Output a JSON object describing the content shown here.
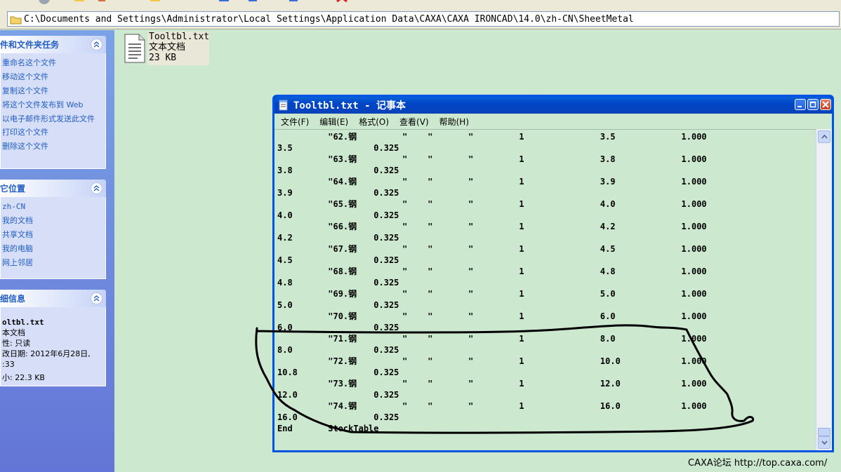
{
  "address_bar": {
    "path": "C:\\Documents and Settings\\Administrator\\Local Settings\\Application Data\\CAXA\\CAXA IRONCAD\\14.0\\zh-CN\\SheetMetal"
  },
  "task_pane": {
    "file_tasks": {
      "title": "件和文件夹任务",
      "items": [
        "重命名这个文件",
        "移动这个文件",
        "复制这个文件",
        "将这个文件发布到 Web",
        "以电子邮件形式发送此文件",
        "打印这个文件",
        "删除这个文件"
      ]
    },
    "other_places": {
      "title": "它位置",
      "items": [
        "zh-CN",
        "我的文档",
        "共享文档",
        "我的电脑",
        "网上邻居"
      ]
    },
    "details": {
      "title": "细信息",
      "lines": [
        "oltbl.txt",
        "本文档",
        "性: 只读",
        "改日期: 2012年6月28日, ",
        ":33",
        "小: 22.3 KB"
      ]
    }
  },
  "file_item": {
    "name": "Tooltbl.txt",
    "type": "文本文档",
    "size": "23 KB",
    "icon": "text-file-icon"
  },
  "notepad": {
    "title": "Tooltbl.txt - 记事本",
    "menus": [
      "文件(F)",
      "编辑(E)",
      "格式(O)",
      "查看(V)",
      "帮助(H)"
    ],
    "lines": [
      "          \"62.钢         \"    \"       \"         1               3.5             1.000",
      "3.5                0.325",
      "          \"63.钢         \"    \"       \"         1               3.8             1.000",
      "3.8                0.325",
      "          \"64.钢         \"    \"       \"         1               3.9             1.000",
      "3.9                0.325",
      "          \"65.钢         \"    \"       \"         1               4.0             1.000",
      "4.0                0.325",
      "          \"66.钢         \"    \"       \"         1               4.2             1.000",
      "4.2                0.325",
      "          \"67.钢         \"    \"       \"         1               4.5             1.000",
      "4.5                0.325",
      "          \"68.钢         \"    \"       \"         1               4.8             1.000",
      "4.8                0.325",
      "          \"69.钢         \"    \"       \"         1               5.0             1.000",
      "5.0                0.325",
      "          \"70.钢         \"    \"       \"         1               6.0             1.000",
      "6.0                0.325",
      "          \"71.钢         \"    \"       \"         1               8.0             1.000",
      "8.0                0.325",
      "          \"72.钢         \"    \"       \"         1               10.0            1.000",
      "10.8               0.325",
      "          \"73.钢         \"    \"       \"         1               12.0            1.000",
      "12.0               0.325",
      "          \"74.钢         \"    \"       \"         1               16.0            1.000",
      "16.0               0.325",
      "End       StockTable"
    ]
  },
  "watermark": "CAXA论坛 http://top.caxa.com/",
  "colors": {
    "workspace_bg": "#cce8cf",
    "titlebar": "#0a5fd8",
    "taskpane": "#6b8be0",
    "link": "#215dc6",
    "annotation_ink": "#000000"
  }
}
